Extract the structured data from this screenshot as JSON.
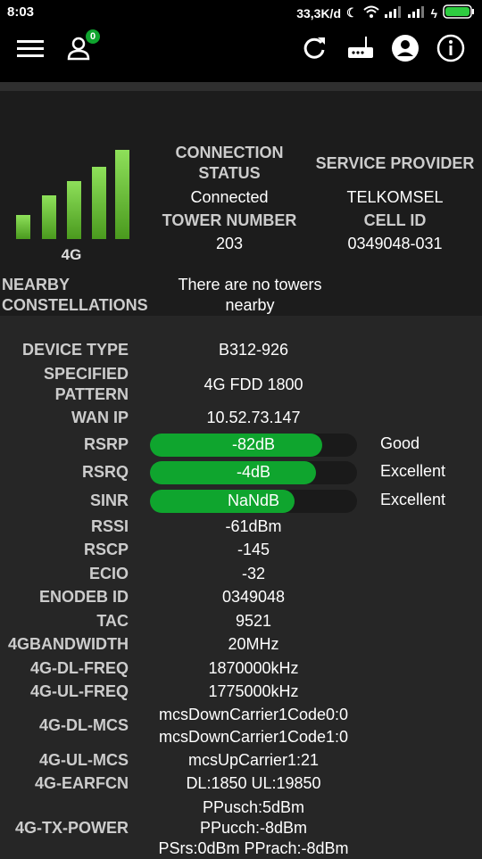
{
  "status_bar": {
    "time": "8:03",
    "speed": "33,3K/d",
    "battery_color": "#2ecc40"
  },
  "app_bar": {
    "icons": [
      "menu-icon",
      "user-icon",
      "refresh-icon",
      "router-icon",
      "account-icon",
      "info-icon"
    ],
    "user_badge": "0",
    "accent": "#0fa52e"
  },
  "signal": {
    "network": "4G",
    "bar_levels": [
      0.27,
      0.49,
      0.65,
      0.81,
      1.0
    ]
  },
  "connection": {
    "status_header": "CONNECTION STATUS",
    "status": "Connected",
    "provider_header": "SERVICE PROVIDER",
    "provider": "TELKOMSEL",
    "tower_header": "TOWER NUMBER",
    "tower": "203",
    "cell_header": "CELL ID",
    "cell": "0349048-031"
  },
  "nearby": {
    "header": "NEARBY CONSTELLATIONS",
    "value": "There are no towers nearby"
  },
  "device": {
    "device_type_label": "DEVICE TYPE",
    "device_type": "B312-926",
    "pattern_label": "SPECIFIED PATTERN",
    "pattern": "4G FDD 1800",
    "wan_label": "WAN IP",
    "wan": "10.52.73.147",
    "rsrp_label": "RSRP",
    "rsrp": "-82dB",
    "rsrp_quality": "Good",
    "rsrp_level": 0.83,
    "rsrq_label": "RSRQ",
    "rsrq": "-4dB",
    "rsrq_quality": "Excellent",
    "rsrq_level": 0.8,
    "sinr_label": "SINR",
    "sinr": "NaNdB",
    "sinr_quality": "Excellent",
    "sinr_level": 0.7,
    "rssi_label": "RSSI",
    "rssi": "-61dBm",
    "rscp_label": "RSCP",
    "rscp": "-145",
    "ecio_label": "ECIO",
    "ecio": "-32",
    "enodeb_label": "ENODEB ID",
    "enodeb": "0349048",
    "tac_label": "TAC",
    "tac": "9521",
    "bw_label": "4GBANDWIDTH",
    "bw": "20MHz",
    "dlfreq_label": "4G-DL-FREQ",
    "dlfreq": "1870000kHz",
    "ulfreq_label": "4G-UL-FREQ",
    "ulfreq": "1775000kHz",
    "dlmcs_label": "4G-DL-MCS",
    "dlmcs_1": "mcsDownCarrier1Code0:0",
    "dlmcs_2": "mcsDownCarrier1Code1:0",
    "ulmcs_label": "4G-UL-MCS",
    "ulmcs": "mcsUpCarrier1:21",
    "earfcn_label": "4G-EARFCN",
    "earfcn": "DL:1850 UL:19850",
    "txpower_label": "4G-TX-POWER",
    "tx_1": "PPusch:5dBm",
    "tx_2": "PPucch:-8dBm",
    "tx_3": "PSrs:0dBm PPrach:-8dBm"
  }
}
